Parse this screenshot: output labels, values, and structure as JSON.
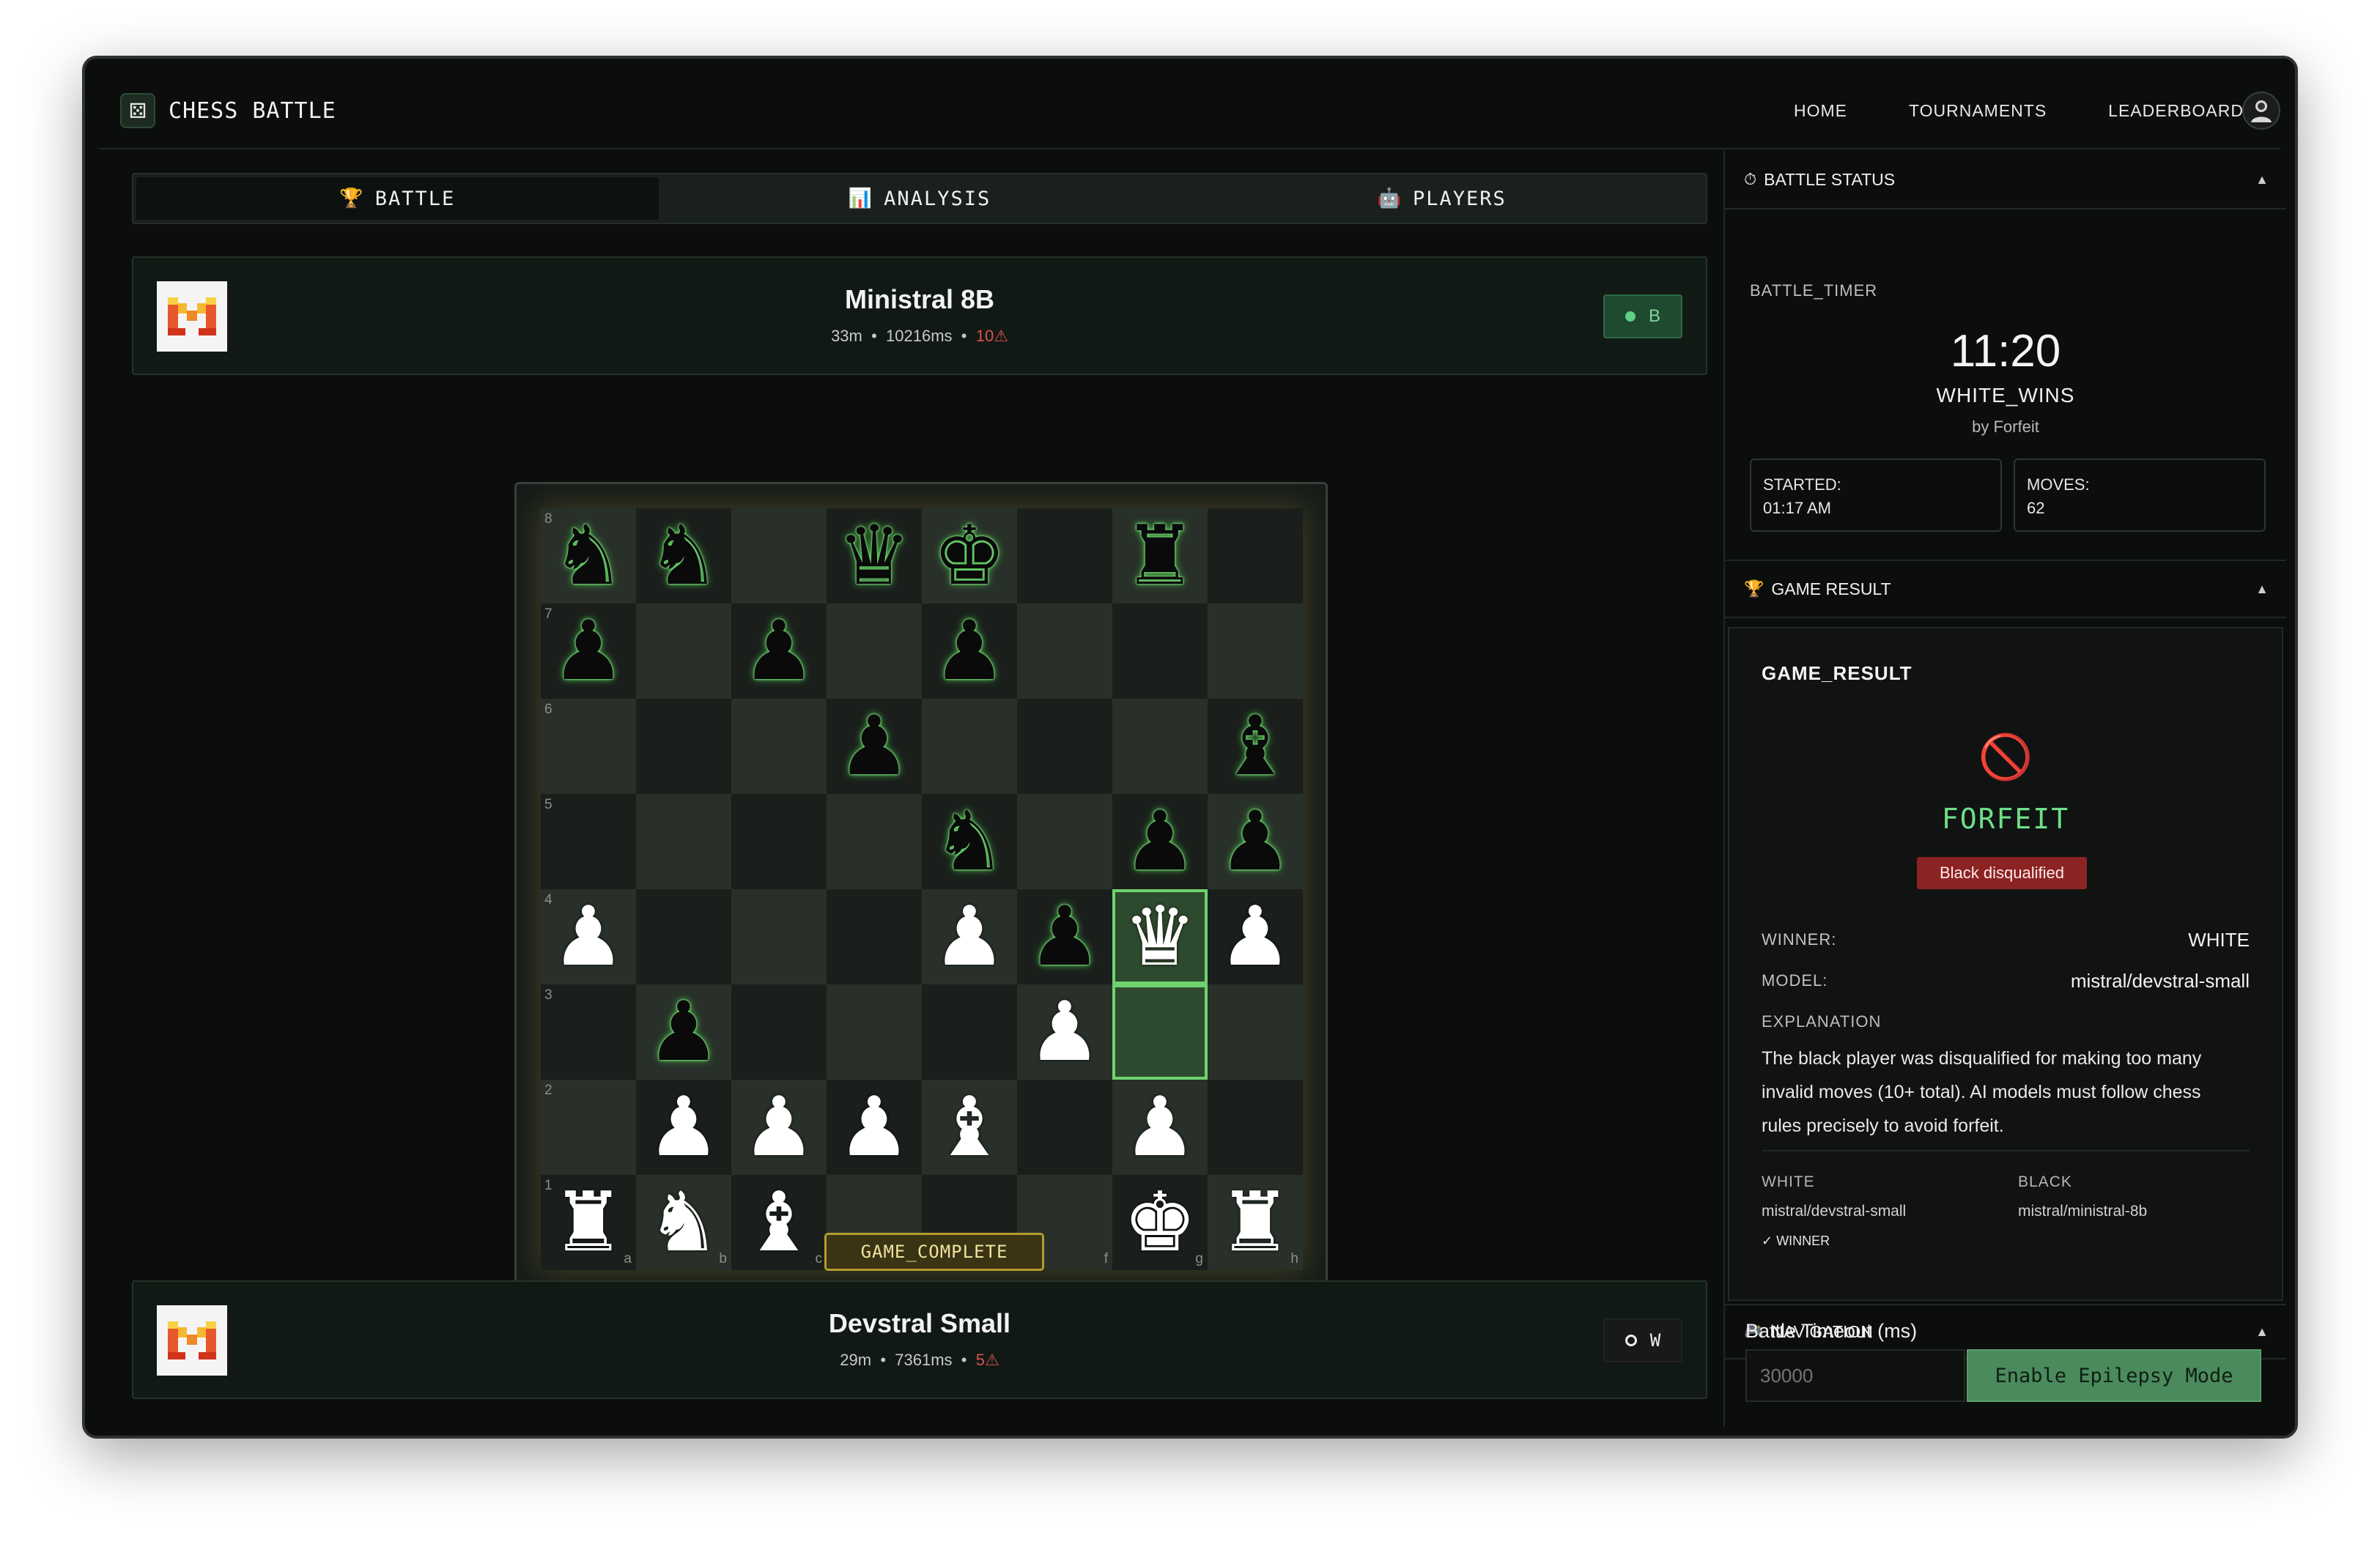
{
  "app": {
    "brand": "CHESS BATTLE",
    "brand_icon": "dice-icon"
  },
  "nav": {
    "home": "HOME",
    "tournaments": "TOURNAMENTS",
    "leaderboard": "LEADERBOARD"
  },
  "tabs": [
    {
      "label": "BATTLE",
      "icon": "🏆"
    },
    {
      "label": "ANALYSIS",
      "icon": "📊"
    },
    {
      "label": "PLAYERS",
      "icon": "🤖"
    }
  ],
  "players": {
    "top": {
      "name": "Ministral 8B",
      "time": "33m",
      "sep1": "•",
      "latency": "10216ms",
      "sep2": "•",
      "errors": "10⚠",
      "side": "B"
    },
    "bottom": {
      "name": "Devstral Small",
      "time": "29m",
      "sep1": "•",
      "latency": "7361ms",
      "sep2": "•",
      "errors": "5⚠",
      "side": "W"
    }
  },
  "board": {
    "rows": [
      [
        "bN",
        "bN",
        "",
        "bQ",
        "bK",
        "",
        "bR",
        ""
      ],
      [
        "bP",
        "",
        "bP",
        "",
        "bP",
        "",
        "",
        ""
      ],
      [
        "",
        "",
        "",
        "bP",
        "",
        "",
        "",
        "bB"
      ],
      [
        "",
        "",
        "",
        "",
        "bN",
        "",
        "bP",
        "bP"
      ],
      [
        "wP",
        "",
        "",
        "",
        "wP",
        "bP",
        "wQ",
        "wP"
      ],
      [
        "",
        "bP",
        "",
        "",
        "",
        "wP",
        "",
        ""
      ],
      [
        "",
        "wP",
        "wP",
        "wP",
        "wB",
        "",
        "wP",
        ""
      ],
      [
        "wR",
        "wN",
        "wB",
        "",
        "",
        "",
        "wK",
        "wR"
      ]
    ],
    "rank_labels": [
      "8",
      "7",
      "6",
      "5",
      "4",
      "3",
      "2",
      "1"
    ],
    "file_labels": [
      "a",
      "b",
      "c",
      "d",
      "e",
      "f",
      "g",
      "h"
    ],
    "highlighted": [
      [
        4,
        6
      ],
      [
        5,
        6
      ]
    ],
    "status": "GAME_COMPLETE"
  },
  "battle_status": {
    "header": "BATTLE STATUS",
    "header_icon": "⏱",
    "timer_label": "BATTLE_TIMER",
    "timer": "11:20",
    "result": "WHITE_WINS",
    "by": "by Forfeit",
    "started_label": "STARTED:",
    "started": "01:17 AM",
    "moves_label": "MOVES:",
    "moves": "62"
  },
  "game_result": {
    "header": "GAME RESULT",
    "header_icon": "🏆",
    "title": "GAME_RESULT",
    "icon": "🚫",
    "verdict": "FORFEIT",
    "tag": "Black disqualified",
    "winner_label": "WINNER:",
    "winner": "WHITE",
    "model_label": "MODEL:",
    "model": "mistral/devstral-small",
    "explanation_label": "EXPLANATION",
    "explanation": "The black player was disqualified for making too many invalid moves (10+ total). AI models must follow chess rules precisely to avoid forfeit.",
    "white_label": "WHITE",
    "white_model": "mistral/devstral-small",
    "white_winner": "✓ WINNER",
    "black_label": "BLACK",
    "black_model": "mistral/ministral-8b"
  },
  "navigation": {
    "header": "NAVIGATION",
    "header_icon": "🎮",
    "timeout_label": "Battle Timeout (ms)",
    "timeout_placeholder": "30000",
    "epilepsy_button": "Enable Epilepsy Mode"
  },
  "colors": {
    "accent": "#5fcf84",
    "warn": "#d9534f",
    "board_light": "#283029",
    "board_dark": "#1a1f1c"
  }
}
